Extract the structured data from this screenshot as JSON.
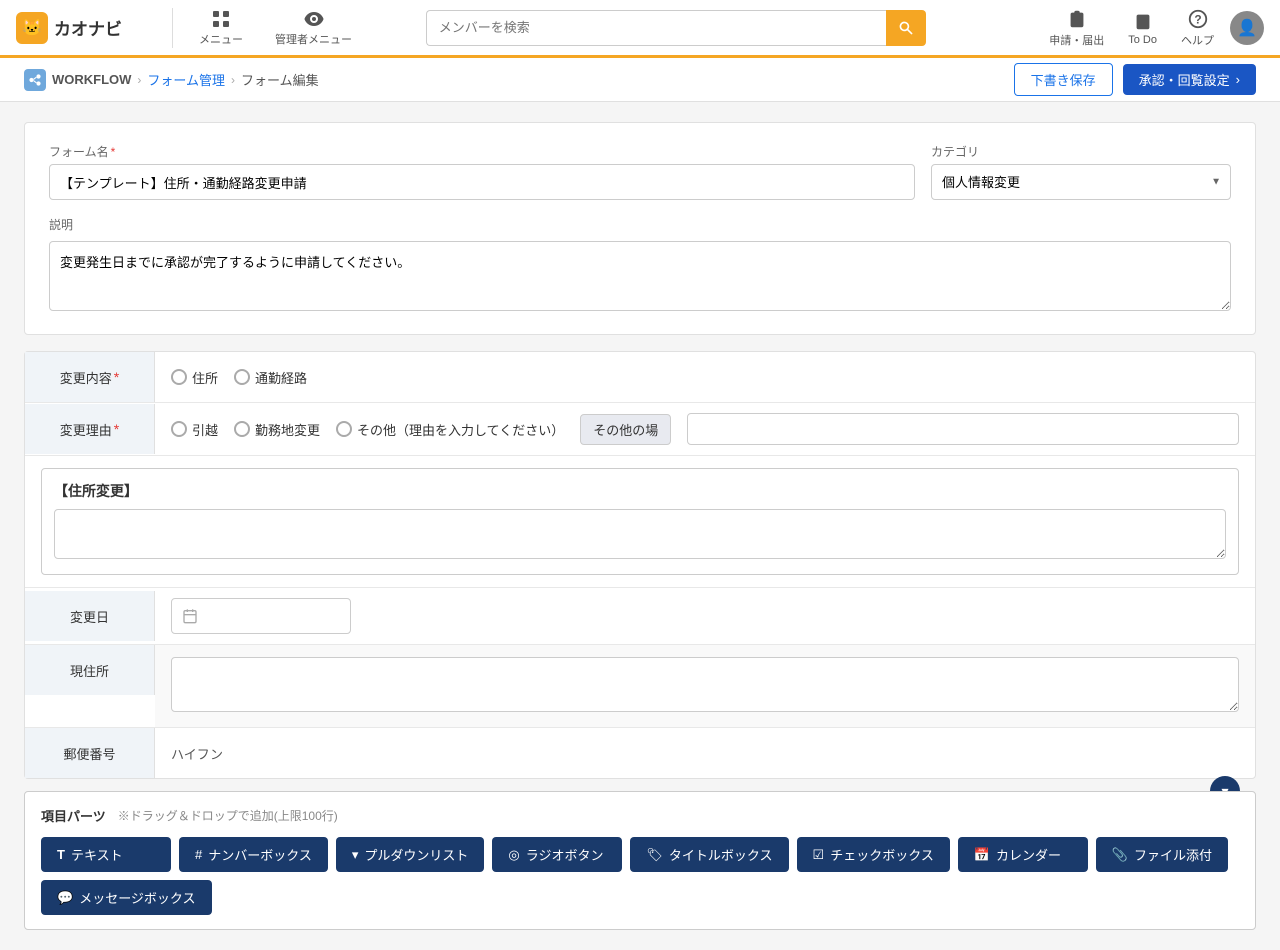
{
  "header": {
    "logo_text": "カオナビ",
    "menu_label": "メニュー",
    "admin_menu_label": "管理者メニュー",
    "search_placeholder": "メンバーを検索",
    "apply_label": "申請・届出",
    "todo_label": "To Do",
    "help_label": "ヘルプ"
  },
  "breadcrumb": {
    "workflow_label": "WORKFLOW",
    "form_mgmt_label": "フォーム管理",
    "form_edit_label": "フォーム編集",
    "draft_save_label": "下書き保存",
    "approve_label": "承認・回覧設定"
  },
  "form": {
    "name_label": "フォーム名",
    "name_required": "*",
    "name_value": "【テンプレート】住所・通勤経路変更申請",
    "category_label": "カテゴリ",
    "category_value": "個人情報変更",
    "description_label": "説明",
    "description_value": "変更発生日までに承認が完了するように申請してください。"
  },
  "fields": {
    "change_content": {
      "label": "変更内容",
      "required": true,
      "options": [
        "住所",
        "通勤経路"
      ]
    },
    "change_reason": {
      "label": "変更理由",
      "required": true,
      "options": [
        "引越",
        "勤務地変更",
        "その他（理由を入力してください）"
      ],
      "other_btn": "その他の場",
      "other_placeholder": ""
    },
    "address_change_title": "【住所変更】",
    "change_date": {
      "label": "変更日",
      "placeholder": ""
    },
    "current_address": {
      "label": "現住所"
    },
    "postal_number": {
      "label": "郵便番号"
    },
    "hyphen": "ハイフン"
  },
  "parts_panel": {
    "title": "項目パーツ",
    "note": "※ドラッグ＆ドロップで追加(上限100行)",
    "parts": [
      {
        "id": "text",
        "label": "テキスト",
        "icon": "T"
      },
      {
        "id": "number",
        "label": "ナンバーボックス",
        "icon": "#"
      },
      {
        "id": "dropdown",
        "label": "プルダウンリスト",
        "icon": "▾"
      },
      {
        "id": "radio",
        "label": "ラジオボタン",
        "icon": "◎"
      },
      {
        "id": "title",
        "label": "タイトルボックス",
        "icon": "🏷"
      },
      {
        "id": "checkbox",
        "label": "チェックボックス",
        "icon": "☑"
      },
      {
        "id": "calendar",
        "label": "カレンダー",
        "icon": "📅"
      },
      {
        "id": "file",
        "label": "ファイル添付",
        "icon": "📎"
      },
      {
        "id": "message",
        "label": "メッセージボックス",
        "icon": "💬"
      }
    ]
  }
}
